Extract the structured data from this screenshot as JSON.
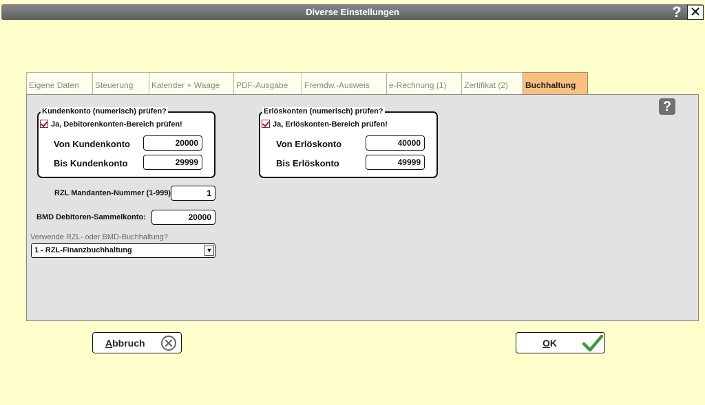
{
  "window": {
    "title": "Diverse Einstellungen"
  },
  "tabs": [
    {
      "label": "Eigene Daten"
    },
    {
      "label": "Steuerung"
    },
    {
      "label": "Kalender + Waage"
    },
    {
      "label": "PDF-Ausgabe"
    },
    {
      "label": "Fremdw.-Ausweis"
    },
    {
      "label": "e-Rechnung (1)"
    },
    {
      "label": "Zertifikat (2)"
    },
    {
      "label": "Buchhaltung"
    }
  ],
  "active_tab": "Buchhaltung",
  "kundenkonto": {
    "title": "Kundenkonto (numerisch) prüfen?",
    "checkbox_label": "Ja, Debitorenkonten-Bereich prüfen!",
    "checked": true,
    "von_label": "Von Kundenkonto",
    "von_value": "20000",
    "bis_label": "Bis Kundenkonto",
    "bis_value": "29999"
  },
  "erloeskonten": {
    "title": "Erlöskonten (numerisch) prüfen?",
    "checkbox_label": "Ja, Erlöskonten-Bereich prüfen!",
    "checked": true,
    "von_label": "Von Erlöskonto",
    "von_value": "40000",
    "bis_label": "Bis Erlöskonto",
    "bis_value": "49999"
  },
  "rzl": {
    "label": "RZL Mandanten-Nummer (1-999):",
    "value": "1"
  },
  "bmd": {
    "label": "BMD Debitoren-Sammelkonto:",
    "value": "20000"
  },
  "buchhaltung_select": {
    "label": "Verwende RZL- oder BMD-Buchhaltung?",
    "value": "1 - RZL-Finanzbuchhaltung"
  },
  "buttons": {
    "cancel_rest": "bbruch",
    "cancel_mnemonic": "A",
    "ok_rest": "K",
    "ok_mnemonic": "O"
  },
  "colors": {
    "background": "#ffffcc",
    "active_tab": "#fac080",
    "panel": "#e2e2e2",
    "check_red": "#cc0000",
    "ok_green": "#3a9a3a"
  }
}
